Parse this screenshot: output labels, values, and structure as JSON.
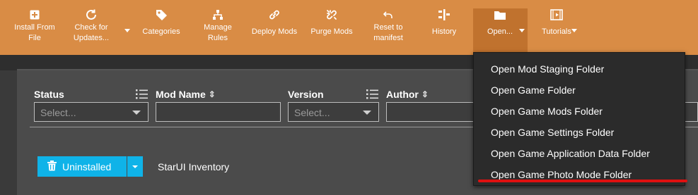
{
  "toolbar": {
    "buttons": [
      {
        "label": "Install From\nFile",
        "icon": "plus-square-icon"
      },
      {
        "label": "Check for\nUpdates...",
        "icon": "refresh-icon"
      },
      {
        "label": "Categories",
        "icon": "tag-icon"
      },
      {
        "label": "Manage\nRules",
        "icon": "sitemap-icon"
      },
      {
        "label": "Deploy Mods",
        "icon": "link-icon"
      },
      {
        "label": "Purge Mods",
        "icon": "unlink-icon"
      },
      {
        "label": "Reset to\nmanifest",
        "icon": "undo-icon"
      },
      {
        "label": "History",
        "icon": "history-icon"
      },
      {
        "label": "Open...",
        "icon": "folder-icon"
      },
      {
        "label": "Tutorials",
        "icon": "film-icon"
      }
    ],
    "accent": "#d98c45",
    "active_accent": "#c0722e"
  },
  "table": {
    "columns": [
      {
        "label": "Status",
        "filter_placeholder": "Select..."
      },
      {
        "label": "Mod Name",
        "filter_placeholder": ""
      },
      {
        "label": "Version",
        "filter_placeholder": "Select..."
      },
      {
        "label": "Author",
        "filter_placeholder": ""
      }
    ],
    "rows": [
      {
        "status_label": "Uninstalled",
        "status_color": "#0fb3e8",
        "name": "StarUI Inventory"
      }
    ]
  },
  "open_menu": {
    "items": [
      "Open Mod Staging Folder",
      "Open Game Folder",
      "Open Game Mods Folder",
      "Open Game Settings Folder",
      "Open Game Application Data Folder",
      "Open Game Photo Mode Folder"
    ],
    "highlight_color": "#e01010"
  }
}
